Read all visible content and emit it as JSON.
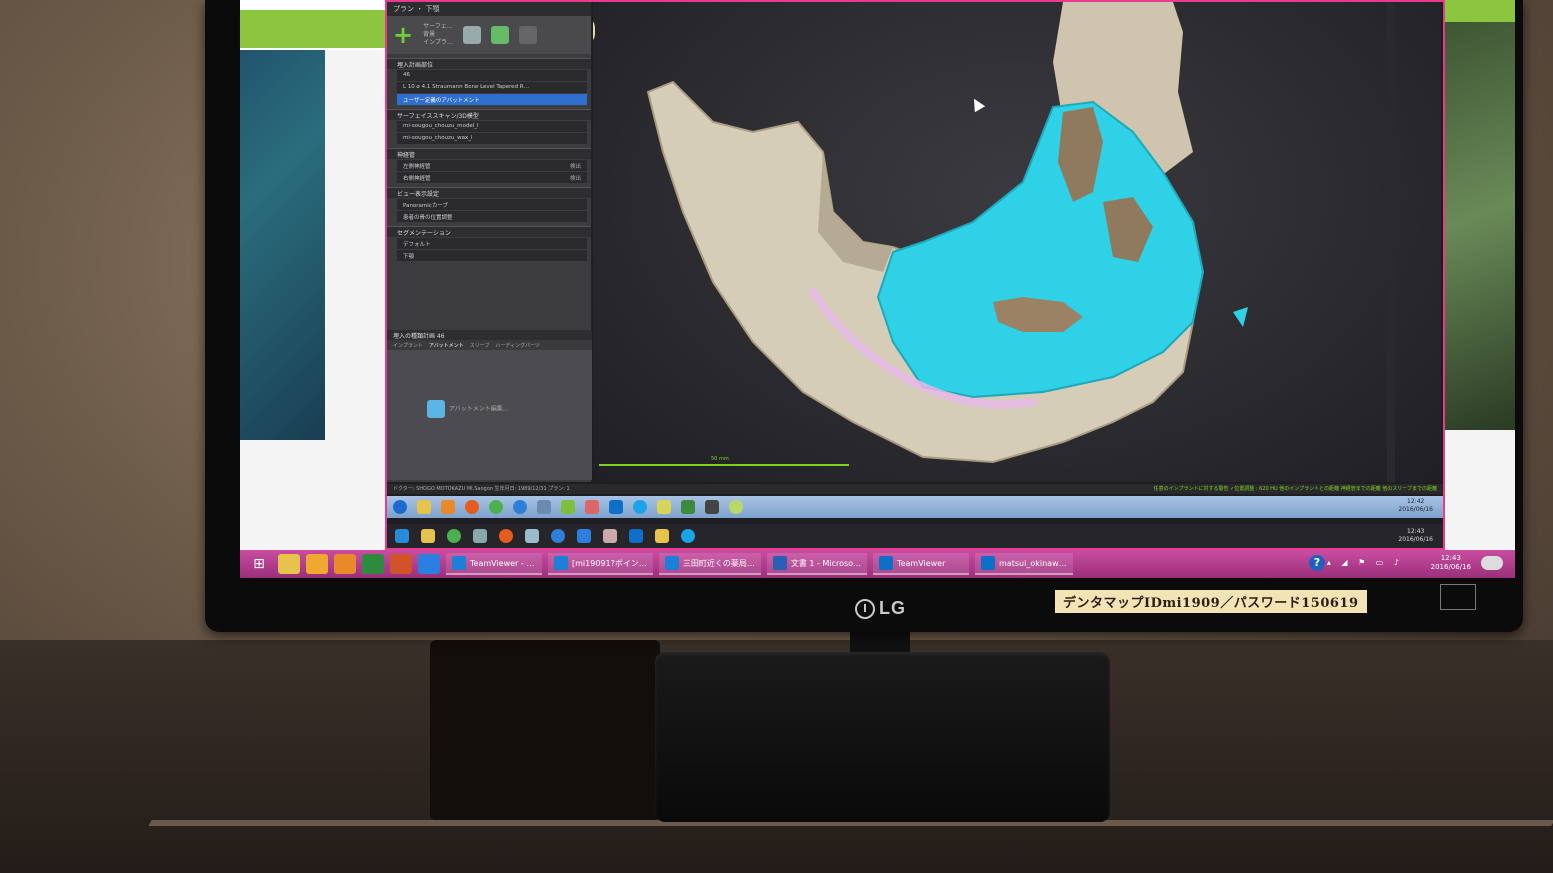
{
  "planning_app": {
    "plan_header": "プラン ・ 下顎",
    "toolbar": {
      "tool_text_lines": [
        "サーフェ…",
        "背景",
        "インプラ…"
      ]
    },
    "sections": [
      {
        "title": "埋入計画部位",
        "items": [
          {
            "label": "46",
            "selected": false
          },
          {
            "label": "L 10 ⌀ 4.1  Straumann Bone Level Tapered R…",
            "selected": false
          },
          {
            "label": "ユーザー定義のアバットメント",
            "selected": true
          }
        ]
      },
      {
        "title": "サーフェイススキャン/3D模型",
        "items": [
          {
            "label": "mi-sougou_chouzu_model_l",
            "selected": false
          },
          {
            "label": "mi-sougou_chouzu_wax_l",
            "selected": false
          }
        ]
      },
      {
        "title": "神経管",
        "items": [
          {
            "label": "左側神経管",
            "tag": "検出",
            "selected": false
          },
          {
            "label": "右側神経管",
            "tag": "検出",
            "selected": false
          }
        ]
      },
      {
        "title": "ビュー表示設定",
        "items": [
          {
            "label": "Panoramicカーブ",
            "selected": false
          },
          {
            "label": "患者の骨の位置調整",
            "selected": false
          }
        ]
      },
      {
        "title": "セグメンテーション",
        "items": [
          {
            "label": "デフォルト",
            "selected": false
          },
          {
            "label": "下顎",
            "selected": false
          }
        ]
      }
    ],
    "lower_panel": {
      "title": "埋入の種類計画 46",
      "tabs": [
        "インプラント",
        "アバットメント",
        "スリーブ",
        "ハーディングパーツ"
      ],
      "abutment_button": "アバットメント編集…"
    },
    "scale_bar_label": "50 mm",
    "status_left": "ドクター: SHOGO MOTOKAZU MI.Saogon   生年月日: 1989/12/31   プラン: 1",
    "status_right": "任意のインプラントに対する警告   ✓位置調整 : 620 HU   他のインプラントとの距離   神経管までの距離   他のスリーブまでの距離",
    "inner_clock": {
      "time": "12:42",
      "date": "2016/06/16"
    }
  },
  "teamviewer_taskbar": {
    "clock": {
      "time": "12:43",
      "date": "2016/06/16"
    }
  },
  "host_taskbar": {
    "tasks": [
      {
        "label": "TeamViewer - …",
        "icon_color": "#1e7fd8"
      },
      {
        "label": "[mi19091?ボイン…",
        "icon_color": "#1e7fd8"
      },
      {
        "label": "三田町近くの薬局…",
        "icon_color": "#1e7fd8"
      },
      {
        "label": "文書 1 - Microso…",
        "icon_color": "#2b5fb3"
      },
      {
        "label": "TeamViewer",
        "icon_color": "#0e6fc9"
      },
      {
        "label": "matsui_okinaw…",
        "icon_color": "#0e6fc9"
      }
    ],
    "help_glyph": "?",
    "clock": {
      "time": "12:43",
      "date": "2016/06/16"
    }
  },
  "monitor": {
    "brand": "LG",
    "sticker": "デンタマップIDmi1909／パスワード150619"
  },
  "colors": {
    "accent_pink": "#e83a8e",
    "model_cyan": "#2ed1e6",
    "bone": "#d6cdb8",
    "selected_item": "#2f6fd0",
    "scale_green": "#7ed321"
  }
}
